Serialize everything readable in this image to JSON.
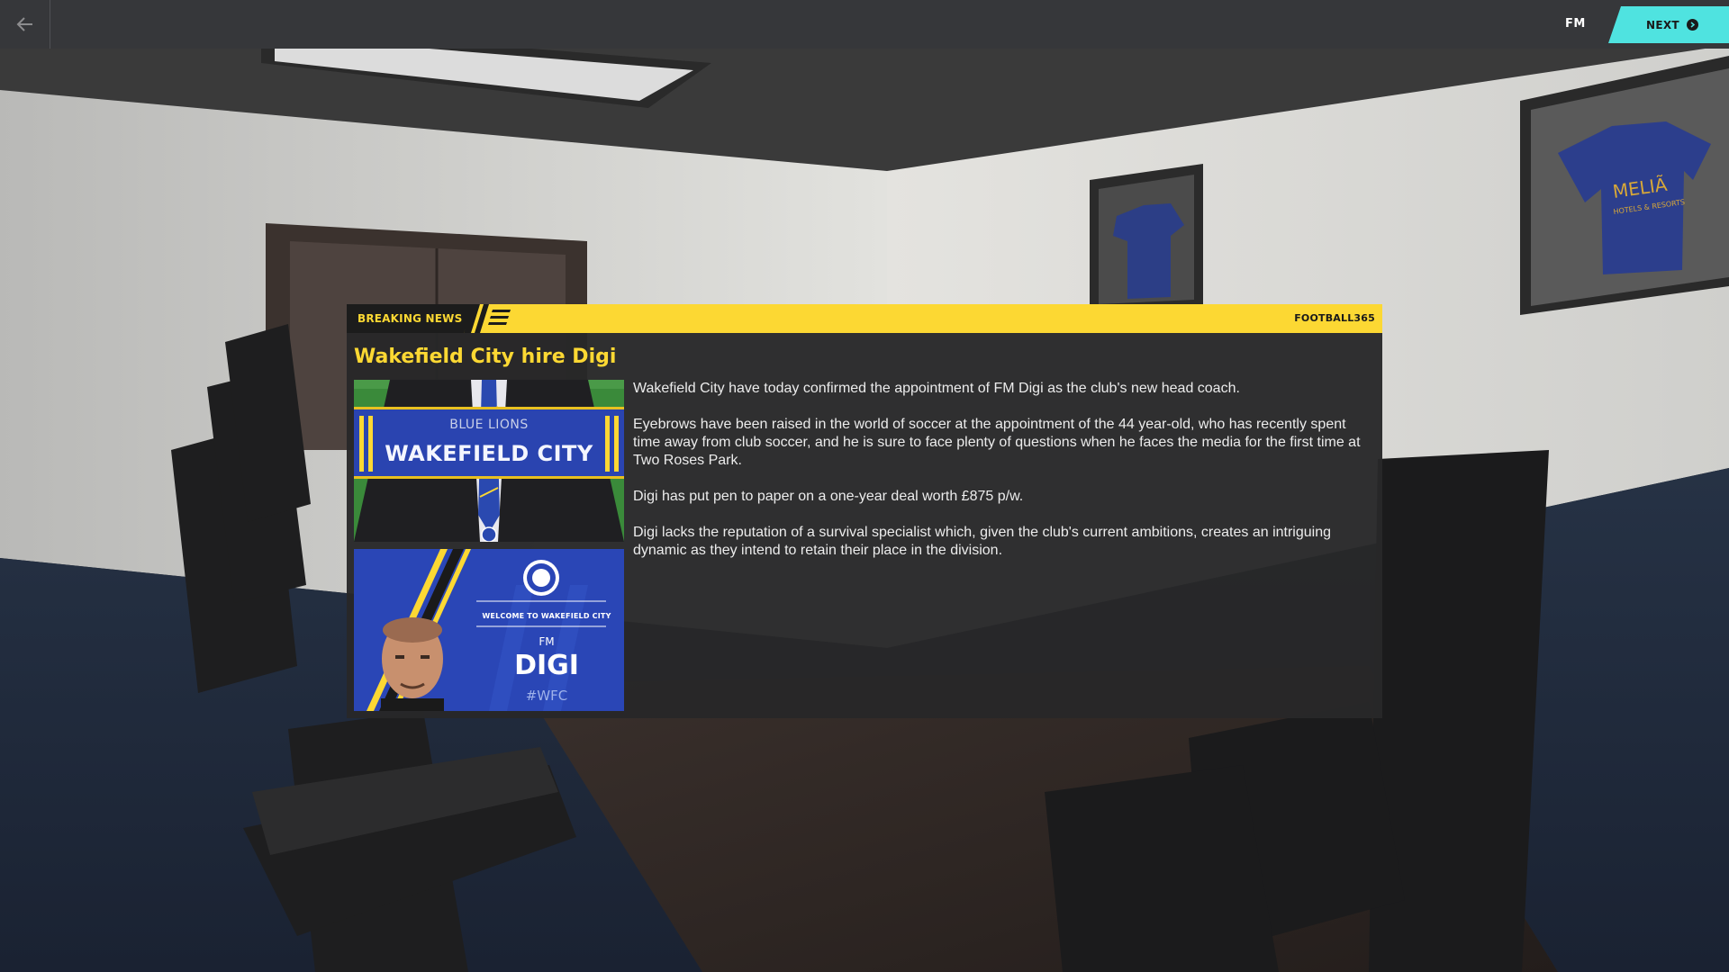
{
  "topbar": {
    "back_icon": "back-arrow-icon",
    "brand": "FM",
    "next_label": "NEXT",
    "next_icon": "chevron-right-circle-icon",
    "accent_color": "#4fe3e0"
  },
  "news": {
    "tag": "BREAKING NEWS",
    "source": "FOOTBALL365",
    "headline": "Wakefield City hire Digi",
    "accent_color": "#fcd833",
    "scarf_image": {
      "top_text": "BLUE LIONS",
      "main_text": "WAKEFIELD CITY"
    },
    "welcome_image": {
      "line": "WELCOME TO WAKEFIELD CITY",
      "prefix": "FM",
      "name": "DIGI",
      "hashtag": "#WFC"
    },
    "paragraphs": [
      "Wakefield City have today confirmed the appointment of FM Digi as the club's new head coach.",
      "Eyebrows have been raised in the world of soccer at the appointment of the 44 year-old, who has recently spent time away from club soccer, and he is sure to face plenty of questions when he faces the media for the first time at Two Roses Park.",
      "Digi has put pen to paper on a one-year deal worth £875 p/w.",
      "Digi lacks the reputation of a survival specialist which, given the club's current ambitions, creates an intriguing dynamic as they intend to retain their place in the division."
    ]
  },
  "background": {
    "shirt_sponsor": "MELIÃ",
    "shirt_sponsor_sub": "HOTELS & RESORTS"
  }
}
